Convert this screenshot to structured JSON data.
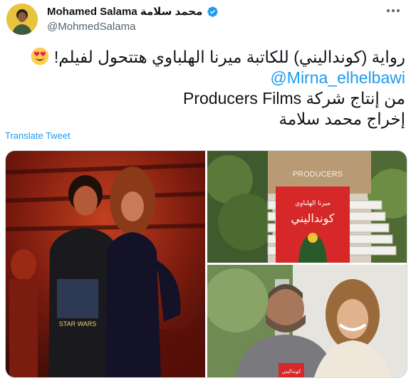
{
  "author": {
    "display_name": "Mohamed Salama محمد سلامة",
    "handle": "@MohmedSalama",
    "verified": true
  },
  "tweet": {
    "lines": [
      "رواية (كونداليني) للكاتبة ميرنا الهلباوي هتتحول لفيلم!",
      "@Mirna_elhelbawi",
      "من إنتاج شركة Producers Films",
      "إخراج محمد سلامة"
    ],
    "emoji": "heart-eyes-emoji"
  },
  "translate_label": "Translate Tweet",
  "media": {
    "photo_2": {
      "book_title": "كونداليني",
      "book_author": "ميرنا الهلباوي",
      "sign_text": "PRODUCERS"
    },
    "photo_3": {
      "book_title": "كونداليني"
    },
    "photo_1": {
      "shirt_text": "STAR WARS"
    }
  },
  "colors": {
    "link": "#1d9bf0",
    "secondary_text": "#536471",
    "verified": "#1d9bf0",
    "border": "#cfd9de"
  }
}
